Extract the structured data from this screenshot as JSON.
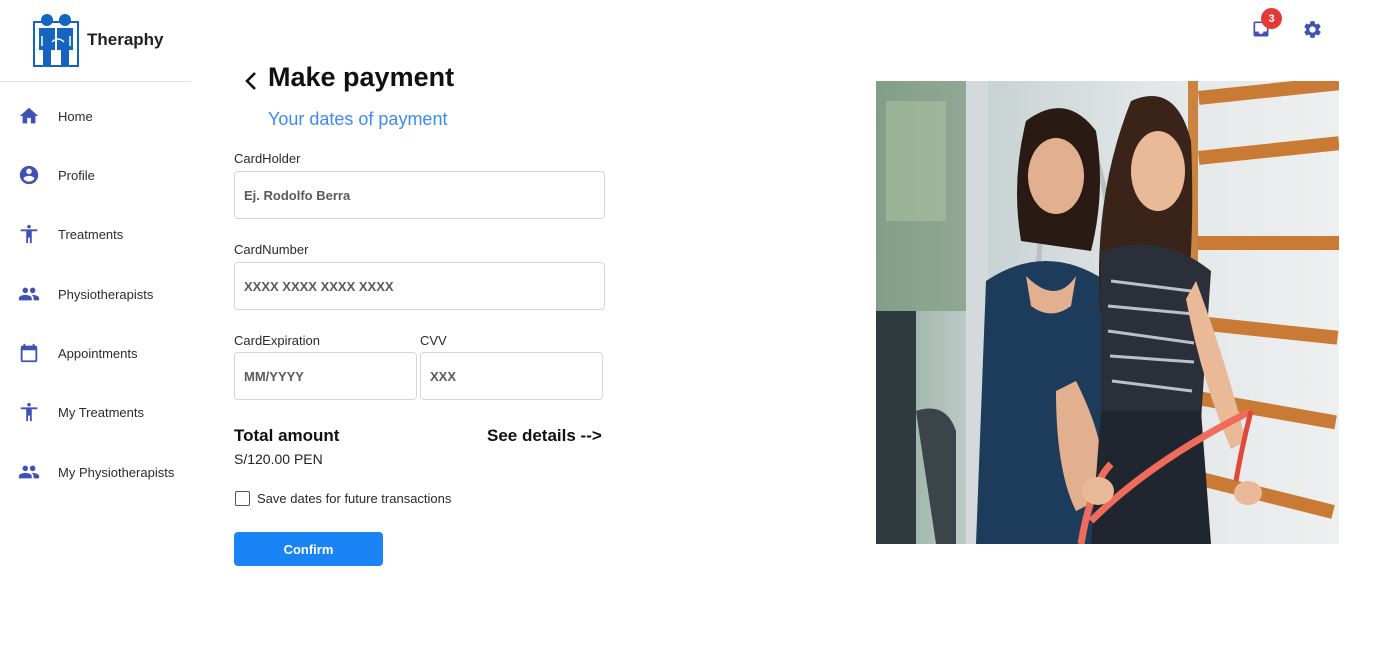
{
  "app": {
    "name": "Theraphy"
  },
  "sidebar": {
    "items": [
      {
        "label": "Home",
        "icon": "home-icon"
      },
      {
        "label": "Profile",
        "icon": "account-circle-icon"
      },
      {
        "label": "Treatments",
        "icon": "accessibility-icon"
      },
      {
        "label": "Physiotherapists",
        "icon": "people-icon"
      },
      {
        "label": "Appointments",
        "icon": "calendar-icon"
      },
      {
        "label": "My Treatments",
        "icon": "accessibility-icon"
      },
      {
        "label": "My Physiotherapists",
        "icon": "people-icon"
      }
    ]
  },
  "topbar": {
    "notification_count": "3",
    "notification_icon": "notification-inbox-icon",
    "settings_icon": "gear-icon"
  },
  "form": {
    "title": "Make payment",
    "subtitle": "Your dates of payment",
    "cardholder": {
      "label": "CardHolder",
      "placeholder": "Ej. Rodolfo Berra"
    },
    "card_number": {
      "label": "CardNumber",
      "placeholder": "XXXX XXXX XXXX XXXX"
    },
    "card_expiration": {
      "label": "CardExpiration",
      "placeholder": "MM/YYYY"
    },
    "cvv": {
      "label": "CVV",
      "placeholder": "XXX"
    },
    "total_label": "Total amount",
    "total_value": "S/120.00 PEN",
    "see_details": "See details -->",
    "save_checkbox_label": "Save dates for future transactions",
    "save_checked": false,
    "confirm_label": "Confirm"
  },
  "colors": {
    "accent": "#3f51b5",
    "subtitle": "#3d8af7",
    "primary_button": "#1a83f5",
    "badge": "#e53935"
  },
  "image": {
    "subject": "physiotherapist-with-patient-photo"
  }
}
